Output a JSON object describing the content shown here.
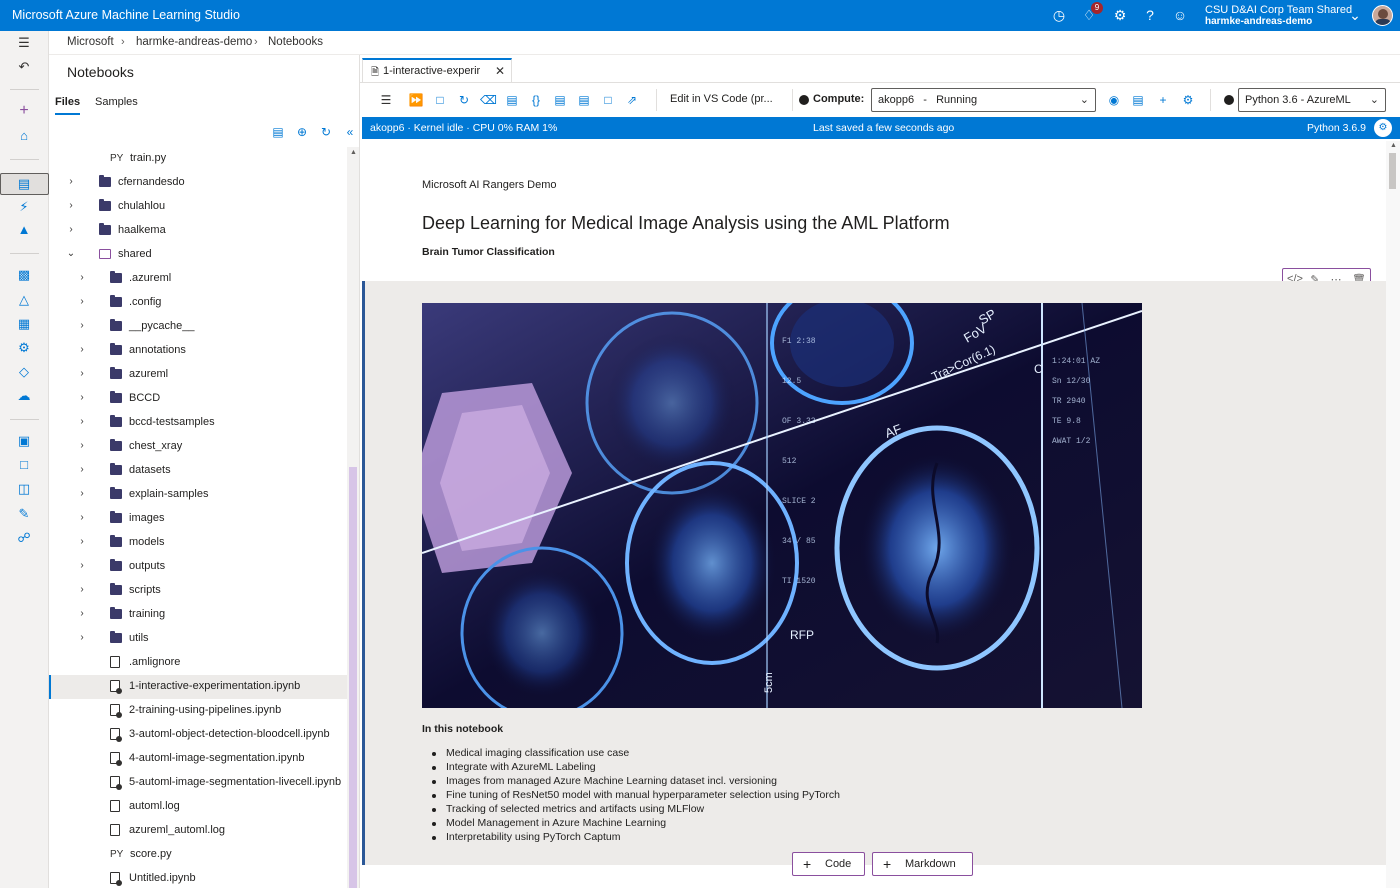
{
  "app": {
    "title": "Microsoft Azure Machine Learning Studio",
    "notifications_count": "9",
    "account_line1": "CSU D&AI Corp Team Shared",
    "account_line2": "harmke-andreas-demo"
  },
  "breadcrumb": [
    "Microsoft",
    "harmke-andreas-demo",
    "Notebooks"
  ],
  "panel": {
    "title": "Notebooks",
    "tabs": [
      "Files",
      "Samples"
    ],
    "tree": [
      {
        "name": "train.py",
        "type": "py",
        "depth": 1
      },
      {
        "name": "cfernandesdo",
        "type": "folder",
        "depth": 0
      },
      {
        "name": "chulahlou",
        "type": "folder",
        "depth": 0
      },
      {
        "name": "haalkema",
        "type": "folder",
        "depth": 0
      },
      {
        "name": "shared",
        "type": "open-folder",
        "depth": 0
      },
      {
        "name": ".azureml",
        "type": "folder",
        "depth": 1
      },
      {
        "name": ".config",
        "type": "folder",
        "depth": 1
      },
      {
        "name": "__pycache__",
        "type": "folder",
        "depth": 1
      },
      {
        "name": "annotations",
        "type": "folder",
        "depth": 1
      },
      {
        "name": "azureml",
        "type": "folder",
        "depth": 1
      },
      {
        "name": "BCCD",
        "type": "folder",
        "depth": 1
      },
      {
        "name": "bccd-testsamples",
        "type": "folder",
        "depth": 1
      },
      {
        "name": "chest_xray",
        "type": "folder",
        "depth": 1
      },
      {
        "name": "datasets",
        "type": "folder",
        "depth": 1
      },
      {
        "name": "explain-samples",
        "type": "folder",
        "depth": 1
      },
      {
        "name": "images",
        "type": "folder",
        "depth": 1
      },
      {
        "name": "models",
        "type": "folder",
        "depth": 1
      },
      {
        "name": "outputs",
        "type": "folder",
        "depth": 1
      },
      {
        "name": "scripts",
        "type": "folder",
        "depth": 1
      },
      {
        "name": "training",
        "type": "folder",
        "depth": 1
      },
      {
        "name": "utils",
        "type": "folder",
        "depth": 1
      },
      {
        "name": ".amlignore",
        "type": "file",
        "depth": 1
      },
      {
        "name": "1-interactive-experimentation.ipynb",
        "type": "notebook",
        "depth": 1,
        "active": true
      },
      {
        "name": "2-training-using-pipelines.ipynb",
        "type": "notebook",
        "depth": 1
      },
      {
        "name": "3-automl-object-detection-bloodcell.ipynb",
        "type": "notebook",
        "depth": 1
      },
      {
        "name": "4-automl-image-segmentation.ipynb",
        "type": "notebook",
        "depth": 1
      },
      {
        "name": "5-automl-image-segmentation-livecell.ipynb",
        "type": "notebook",
        "depth": 1
      },
      {
        "name": "automl.log",
        "type": "file",
        "depth": 1
      },
      {
        "name": "azureml_automl.log",
        "type": "file",
        "depth": 1
      },
      {
        "name": "score.py",
        "type": "py",
        "depth": 1
      },
      {
        "name": "Untitled.ipynb",
        "type": "notebook",
        "depth": 1
      }
    ]
  },
  "editor": {
    "tab_label": "1-interactive-experir",
    "edit_vscode": "Edit in VS Code (pr...",
    "compute_label": "Compute:",
    "compute_value": "akopp6   -   Running",
    "kernel_value": "Python 3.6 - AzureML"
  },
  "status": {
    "left": "akopp6 · Kernel idle · CPU  0%   RAM  1%",
    "center": "Last saved a few seconds ago",
    "right": "Python 3.6.9"
  },
  "notebook": {
    "subtitle": "Microsoft AI Rangers Demo",
    "title": "Deep Learning for Medical Image Analysis using the AML Platform",
    "subheading": "Brain Tumor Classification",
    "in_this_notebook": "In this notebook",
    "bullets": [
      "Medical imaging classification use case",
      "Integrate with AzureML Labeling",
      "Images from managed Azure Machine Learning dataset incl. versioning",
      "Fine tuning of ResNet50 model with manual hyperparameter selection using PyTorch",
      "Tracking of selected metrics and artifacts using MLFlow",
      "Model Management in Azure Machine Learning",
      "Interpretability using PyTorch Captum"
    ],
    "add_code": "Code",
    "add_markdown": "Markdown"
  },
  "image_text": [
    "SP",
    "SL",
    "FoV",
    "Tra>Cor(6.1)",
    "AF",
    "RFP",
    "5cm",
    "C"
  ]
}
